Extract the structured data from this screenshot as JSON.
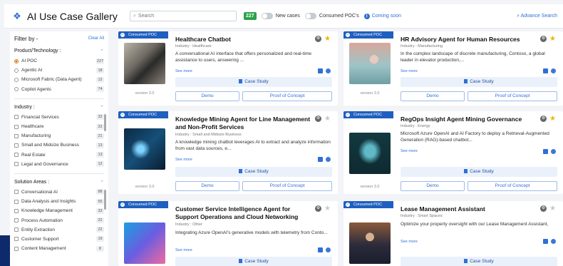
{
  "header": {
    "title": "AI Use Case Gallery",
    "search_placeholder": "Search",
    "result_count": "227",
    "toggle_new": "New cases",
    "toggle_consumed": "Consumed POC's",
    "coming_soon": "Coming soon",
    "advanced_search": "Advance Search"
  },
  "sidebar": {
    "filter_by": "Filter by -",
    "clear_all": "Clear All",
    "groups": [
      {
        "title": "Product/Technology :",
        "type": "radio",
        "items": [
          {
            "label": "AI POC",
            "count": "227",
            "selected": true
          },
          {
            "label": "Agentic AI",
            "count": "18"
          },
          {
            "label": "Microsoft Fabric (Data Agent)",
            "count": "12"
          },
          {
            "label": "Copilot Agents",
            "count": "74"
          }
        ]
      },
      {
        "title": "Industry :",
        "type": "check",
        "items": [
          {
            "label": "Financial Services",
            "count": "32"
          },
          {
            "label": "Healthcare",
            "count": "22"
          },
          {
            "label": "Manufacturing",
            "count": "21"
          },
          {
            "label": "Small and Midsize Business",
            "count": "13"
          },
          {
            "label": "Real Estate",
            "count": "13"
          },
          {
            "label": "Legal and Governance",
            "count": "12"
          }
        ]
      },
      {
        "title": "Solution Areas :",
        "type": "check",
        "items": [
          {
            "label": "Conversational AI",
            "count": "88"
          },
          {
            "label": "Data Analysis and Insights",
            "count": "55"
          },
          {
            "label": "Knowledge Management",
            "count": "33"
          },
          {
            "label": "Process Automation",
            "count": "22"
          },
          {
            "label": "Entity Extraction",
            "count": "22"
          },
          {
            "label": "Customer Support",
            "count": "19"
          },
          {
            "label": "Content Management",
            "count": "8"
          }
        ]
      }
    ]
  },
  "labels": {
    "badge": "Consumed POC",
    "see_more": "See more",
    "case_study": "Case Study",
    "demo": "Demo",
    "poc": "Proof of Concept"
  },
  "cards": [
    {
      "title": "Healthcare Chatbot",
      "industry": "Industry : Healthcare",
      "desc": "A conversational AI interface that offers personalized and real-time assistance to users, answering ...",
      "version": "version 3.0",
      "starred": true
    },
    {
      "title": "HR Advisory Agent for Human Resources",
      "industry": "Industry : Manufacturing",
      "desc": "In the complex landscape of discrete manufacturing, Contoso, a global leader in elevator production,...",
      "version": "version 3.0",
      "starred": true
    },
    {
      "title": "Knowledge Mining Agent for Line Management and Non-Profit Services",
      "industry": "Industry : Small and Midsize Business",
      "desc": "A knowledge mining chatbot leverages AI to extract and analyze information from vast data sources, e...",
      "version": "version 3.0",
      "starred": false
    },
    {
      "title": "RegOps Insight Agent Mining Governance",
      "industry": "Industry : Energy",
      "desc": "Microsoft Azure OpenAI and AI Factory to deploy a Retrieval-Augmented Generation (RAG)-based chatbot...",
      "version": "version 3.0",
      "starred": true
    },
    {
      "title": "Customer Service Intelligence Agent for Support Operations and Cloud Networking",
      "industry": "Industry : Other",
      "desc": "Integrating Azure OpenAI's generative models with telemetry from Conto...",
      "version": "",
      "starred": false
    },
    {
      "title": "Lease Management Assistant",
      "industry": "Industry : Smart Spaces",
      "desc": "Optimize your property oversight with our Lease Management Assistant,",
      "version": "",
      "starred": false
    }
  ]
}
